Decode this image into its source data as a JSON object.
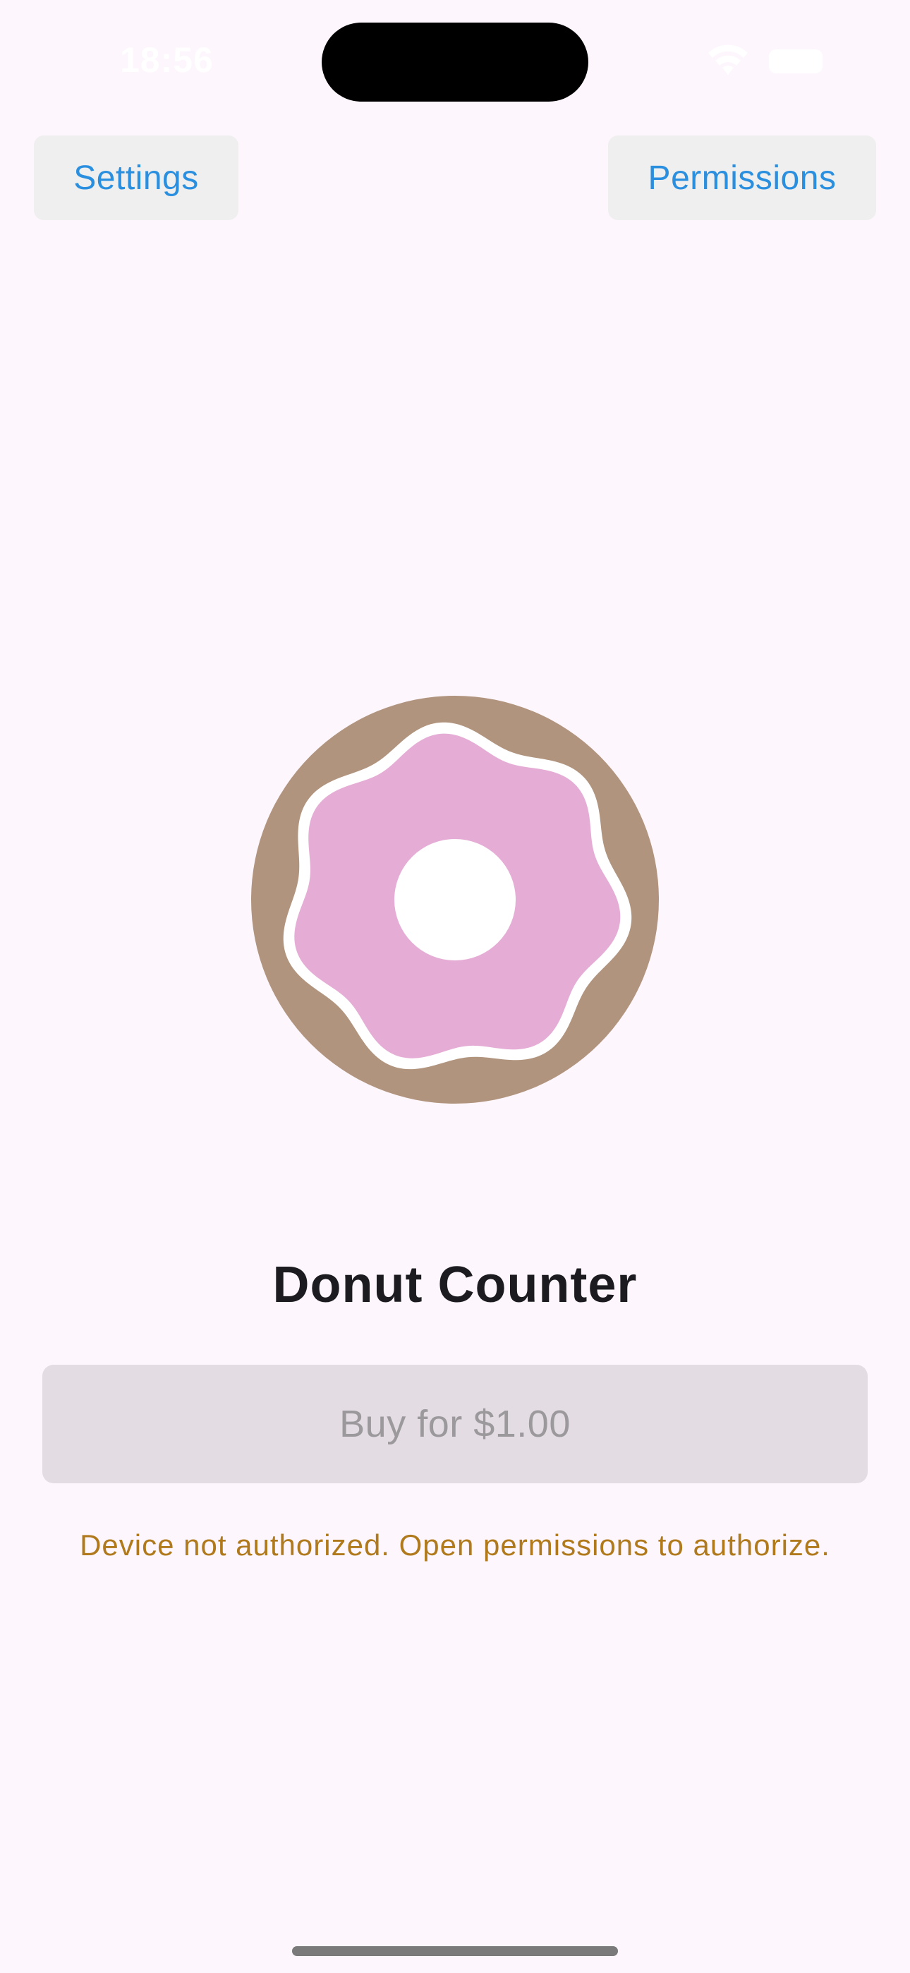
{
  "status_bar": {
    "time": "18:56",
    "wifi_icon": "wifi-icon",
    "battery_icon": "battery-icon"
  },
  "toolbar": {
    "settings_label": "Settings",
    "permissions_label": "Permissions"
  },
  "hero": {
    "icon": "donut-icon",
    "colors": {
      "dough": "#b1947e",
      "icing": "#e5acd5",
      "icing_border": "#ffffff",
      "hole": "#ffffff"
    }
  },
  "main": {
    "title": "Donut Counter",
    "buy_label": "Buy for $1.00",
    "buy_enabled": false,
    "warning": "Device not authorized. Open permissions to authorize."
  },
  "colors": {
    "background": "#fdf6fc",
    "accent": "#2b8fe0",
    "warning": "#b07a1c",
    "disabled_button": "#e3dde3",
    "disabled_text": "#9c999c"
  }
}
